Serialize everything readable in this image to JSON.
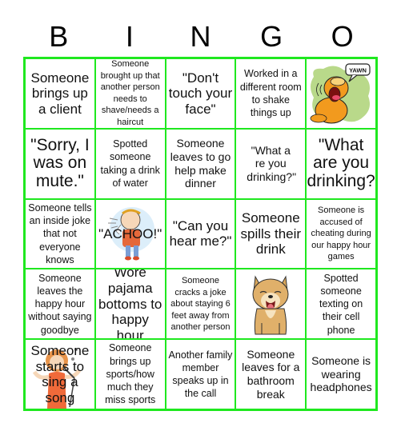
{
  "header": {
    "letters": [
      "B",
      "I",
      "N",
      "G",
      "O"
    ]
  },
  "colors": {
    "grid_border": "#1fe81f",
    "background": "#ffffff",
    "text": "#111111"
  },
  "cells": [
    {
      "text": "Someone brings up a client",
      "size": "lg"
    },
    {
      "text": "Someone brought up that another person needs to shave/needs a haircut",
      "size": "xs"
    },
    {
      "text": "\"Don't touch your face\"",
      "size": "lg"
    },
    {
      "text": "Worked in a different room to shake things up",
      "size": "sm"
    },
    {
      "text": "",
      "image": "garfield-yawn-image",
      "speech": "YAWN"
    },
    {
      "text": "\"Sorry, I was on mute.\"",
      "size": "xl"
    },
    {
      "text": "Spotted someone taking a drink of water",
      "size": "sm"
    },
    {
      "text": "Someone leaves to go help make dinner",
      "size": "md"
    },
    {
      "text": "\"What a re you drinking?\"",
      "size": "md"
    },
    {
      "text": "\"What are you drinking?",
      "size": "xl"
    },
    {
      "text": "Someone tells an inside joke that not everyone knows",
      "size": "sm"
    },
    {
      "text": "\"ACHOO!\"",
      "size": "lg",
      "image": "sneezing-child-image"
    },
    {
      "text": "\"Can you hear me?\"",
      "size": "lg"
    },
    {
      "text": "Someone spills their drink",
      "size": "lg"
    },
    {
      "text": "Someone is accused of cheating during our happy hour games",
      "size": "xs"
    },
    {
      "text": "Someone leaves the happy hour without saying goodbye",
      "size": "sm"
    },
    {
      "text": "Wore pajama bottoms to happy hour",
      "size": "lg"
    },
    {
      "text": "Someone cracks a joke about staying 6 feet away from another person",
      "size": "xs"
    },
    {
      "text": "",
      "image": "shiba-dog-image"
    },
    {
      "text": "Spotted someone texting on their cell phone",
      "size": "sm"
    },
    {
      "text": "Someone starts to sing a song",
      "size": "lg",
      "image": "singer-image"
    },
    {
      "text": "Someone brings up sports/how much they miss sports",
      "size": "sm"
    },
    {
      "text": "Another family member speaks up in the call",
      "size": "sm"
    },
    {
      "text": "Someone leaves for a bathroom break",
      "size": "md"
    },
    {
      "text": "Someone is wearing headphones",
      "size": "md"
    }
  ]
}
